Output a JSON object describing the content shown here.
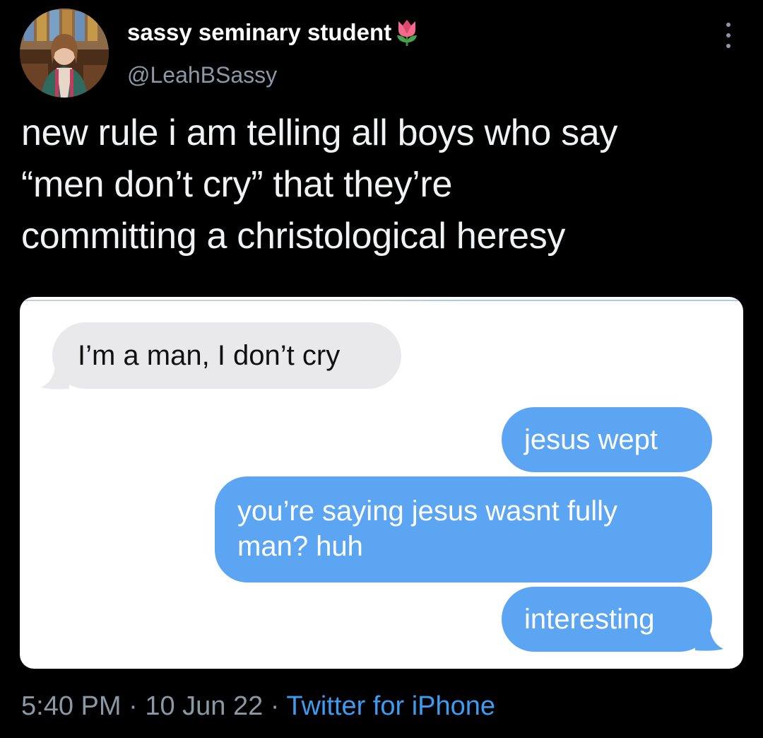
{
  "tweet": {
    "display_name": "sassy seminary student",
    "handle": "@LeahBSassy",
    "text_lines": [
      "new rule i am telling all boys who say",
      "“men don’t cry” that they’re",
      "committing a christological heresy"
    ],
    "time": "5:40 PM",
    "separator": "·",
    "date": "10 Jun 22",
    "source": "Twitter for iPhone"
  },
  "icons": {
    "name_emoji": "tulip-icon",
    "menu": "more-vertical-icon",
    "avatar": "profile-photo"
  },
  "media": {
    "messages": [
      {
        "from": "received",
        "text": "I’m a man, I don’t cry"
      },
      {
        "from": "sent",
        "text": "jesus wept"
      },
      {
        "from": "sent",
        "text": "you’re saying jesus wasnt fully man? huh"
      },
      {
        "from": "sent",
        "text": "interesting"
      }
    ]
  },
  "colors": {
    "background": "#000000",
    "received_bubble": "#e9e9eb",
    "sent_bubble": "#5ca5f2",
    "link": "#3d9cf0",
    "secondary_text": "#8b98a5"
  }
}
